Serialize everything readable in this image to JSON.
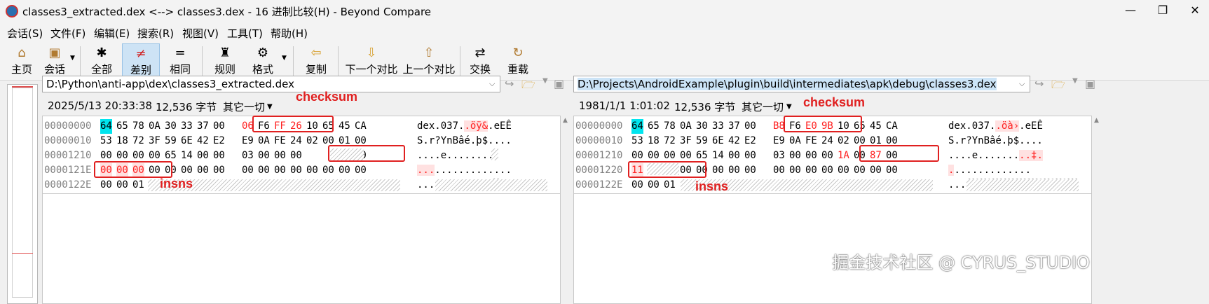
{
  "window": {
    "title": "classes3_extracted.dex <--> classes3.dex - 16 进制比较(H) - Beyond Compare",
    "minimize": "—",
    "maximize": "❐",
    "close": "✕"
  },
  "menu": [
    "会话(S)",
    "文件(F)",
    "编辑(E)",
    "搜索(R)",
    "视图(V)",
    "工具(T)",
    "帮助(H)"
  ],
  "toolbar": {
    "home": "主页",
    "session": "会话",
    "all": "全部",
    "diffs": "差别",
    "same": "相同",
    "rules": "规则",
    "format": "格式",
    "copy": "复制",
    "next": "下一个对比",
    "prev": "上一个对比",
    "swap": "交换",
    "reload": "重载"
  },
  "left": {
    "path": "D:\\Python\\anti-app\\dex\\classes3_extracted.dex",
    "timestamp": "2025/5/13 20:33:38",
    "size": "12,536 字节",
    "other": "其它一切",
    "rows": [
      {
        "offset": "00000000",
        "bytes": [
          "64",
          "65",
          "78",
          "0A",
          "30",
          "33",
          "37",
          "00",
          "06",
          "F6",
          "FF",
          "26",
          "10",
          "65",
          "45",
          "CA"
        ],
        "ascii": "dex.037.",
        "ascii_diff": ".öÿ&",
        "ascii_tail": ".eEÊ"
      },
      {
        "offset": "00000010",
        "bytes": [
          "53",
          "18",
          "72",
          "3F",
          "59",
          "6E",
          "42",
          "E2",
          "E9",
          "0A",
          "FE",
          "24",
          "02",
          "00",
          "01",
          "00"
        ],
        "ascii": "S.r?YnBâé.þ$....",
        "ascii_diff": "",
        "ascii_tail": ""
      },
      {
        "offset": "00001210",
        "bytes": [
          "00",
          "00",
          "00",
          "00",
          "65",
          "14",
          "00",
          "00",
          "03",
          "00",
          "00",
          "00",
          "",
          "",
          "00",
          "00"
        ],
        "ascii": "....e.......",
        "ascii_diff": "",
        "ascii_tail": ".."
      },
      {
        "offset": "0000121E",
        "bytes": [
          "00",
          "00",
          "00",
          "00",
          "00",
          "00",
          "00",
          "00",
          "00",
          "00",
          "00",
          "00",
          "00",
          "00",
          "00",
          "00"
        ],
        "ascii": "",
        "ascii_diff": "...",
        "ascii_tail": "............."
      },
      {
        "offset": "0000122E",
        "bytes": [
          "00",
          "00",
          "01"
        ],
        "ascii": "...",
        "ascii_diff": "",
        "ascii_tail": ""
      }
    ]
  },
  "right": {
    "path": "D:\\Projects\\AndroidExample\\plugin\\build\\intermediates\\apk\\debug\\classes3.dex",
    "timestamp": "1981/1/1 1:01:02",
    "size": "12,536 字节",
    "other": "其它一切",
    "rows": [
      {
        "offset": "00000000",
        "bytes": [
          "64",
          "65",
          "78",
          "0A",
          "30",
          "33",
          "37",
          "00",
          "B8",
          "F6",
          "E0",
          "9B",
          "10",
          "65",
          "45",
          "CA"
        ],
        "ascii": "dex.037.",
        "ascii_diff": ".öà›",
        "ascii_tail": ".eEÊ"
      },
      {
        "offset": "00000010",
        "bytes": [
          "53",
          "18",
          "72",
          "3F",
          "59",
          "6E",
          "42",
          "E2",
          "E9",
          "0A",
          "FE",
          "24",
          "02",
          "00",
          "01",
          "00"
        ],
        "ascii": "S.r?YnBâé.þ$....",
        "ascii_diff": "",
        "ascii_tail": ""
      },
      {
        "offset": "00001210",
        "bytes": [
          "00",
          "00",
          "00",
          "00",
          "65",
          "14",
          "00",
          "00",
          "03",
          "00",
          "00",
          "00",
          "1A",
          "00",
          "87",
          "00"
        ],
        "ascii": "....e.......",
        "ascii_diff": "..‡.",
        "ascii_tail": ""
      },
      {
        "offset": "00001220",
        "bytes": [
          "11",
          "",
          "",
          "00",
          "00",
          "00",
          "00",
          "00",
          "00",
          "00",
          "00",
          "00",
          "00",
          "00",
          "00",
          "00"
        ],
        "ascii": "",
        "ascii_diff": ".",
        "ascii_tail": "............."
      },
      {
        "offset": "0000122E",
        "bytes": [
          "00",
          "00",
          "01"
        ],
        "ascii": "...",
        "ascii_diff": "",
        "ascii_tail": ""
      }
    ]
  },
  "annotations": {
    "checksum": "checksum",
    "insns": "insns"
  },
  "watermark": "掘金技术社区 @ CYRUS_STUDIO",
  "colors": {
    "diff": "#ff2020",
    "highlight_cyan": "#00e5ee",
    "annotation": "#e02020"
  }
}
